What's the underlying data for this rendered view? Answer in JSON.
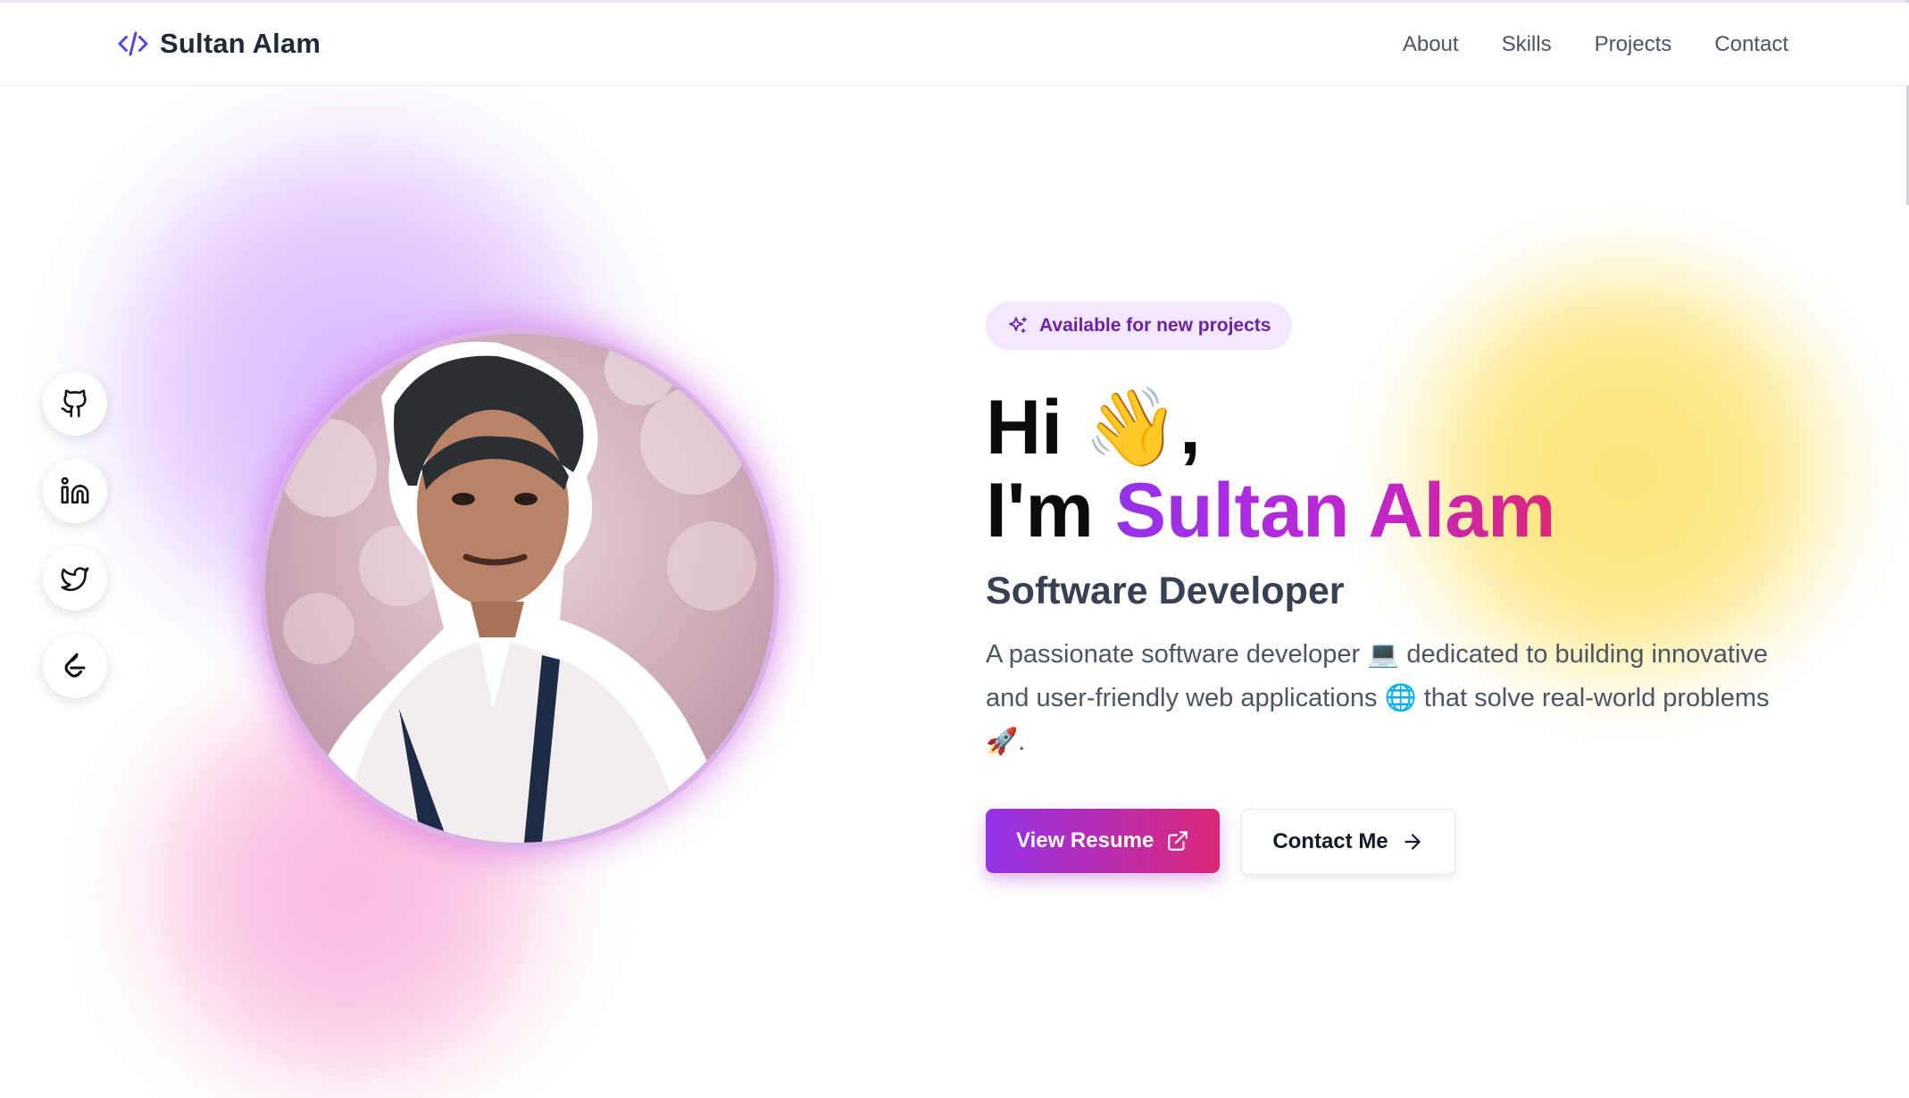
{
  "nav": {
    "brand_name": "Sultan Alam",
    "brand_icon": "code-icon",
    "links": [
      "About",
      "Skills",
      "Projects",
      "Contact"
    ]
  },
  "socials": [
    {
      "icon": "github-icon"
    },
    {
      "icon": "linkedin-icon"
    },
    {
      "icon": "twitter-icon"
    },
    {
      "icon": "leetcode-icon"
    }
  ],
  "hero": {
    "badge": "Available for new projects",
    "badge_icon": "sparkles-icon",
    "greeting": "Hi 👋,",
    "im_prefix": "I'm ",
    "name": "Sultan Alam",
    "role": "Software Developer",
    "description": "A passionate software developer 💻 dedicated to building innovative and user-friendly web applications 🌐 that solve real-world problems 🚀.",
    "primary_button": "View Resume",
    "secondary_button": "Contact Me"
  },
  "colors": {
    "accent_start": "#9333ea",
    "accent_end": "#db2777",
    "badge_bg": "#f3e8ff"
  }
}
